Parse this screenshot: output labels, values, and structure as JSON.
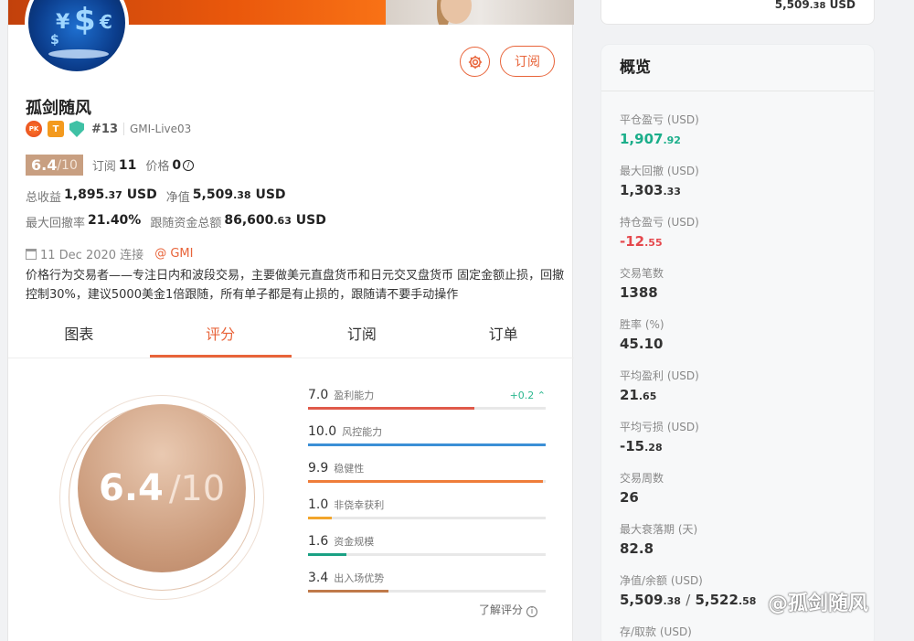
{
  "right_top": {
    "value_main": "5,509",
    "value_small": ".38",
    "unit": "USD"
  },
  "profile": {
    "name": "孤剑随风",
    "badges": {
      "pk": "PK",
      "t": "T"
    },
    "rank": "#13",
    "account": "GMI-Live03",
    "score": "6.4",
    "score_den": "/10",
    "sub_label": "订阅",
    "sub_count": "11",
    "price_label": "价格",
    "price_value": "0",
    "total_profit_label": "总收益",
    "total_profit_main": "1,895",
    "total_profit_small": ".37",
    "total_profit_unit": "USD",
    "equity_label": "净值",
    "equity_main": "5,509",
    "equity_small": ".38",
    "equity_unit": "USD",
    "max_dd_label": "最大回撤率",
    "max_dd_value": "21.40%",
    "follow_label": "跟随资金总额",
    "follow_main": "86,600",
    "follow_small": ".63",
    "follow_unit": "USD",
    "date": "11 Dec 2020 连接",
    "broker": "@ GMI",
    "description": "价格行为交易者——专注日内和波段交易，主要做美元直盘货币和日元交叉盘货币 固定金额止损，回撤控制30%，建议5000美金1倍跟随，所有单子都是有止损的，跟随请不要手动操作",
    "subscribe_button": "订阅"
  },
  "tabs": [
    {
      "label": "图表",
      "active": false
    },
    {
      "label": "评分",
      "active": true
    },
    {
      "label": "订阅",
      "active": false
    },
    {
      "label": "订单",
      "active": false
    }
  ],
  "score_panel": {
    "big_score": "6.4",
    "big_den": "/10",
    "metrics": [
      {
        "score": "7.0",
        "name": "盈利能力",
        "fraction": 0.7,
        "color": "#e05a4a",
        "delta": "+0.2"
      },
      {
        "score": "10.0",
        "name": "风控能力",
        "fraction": 1.0,
        "color": "#3b8fd6",
        "delta": ""
      },
      {
        "score": "9.9",
        "name": "稳健性",
        "fraction": 0.99,
        "color": "#ef7d3a",
        "delta": ""
      },
      {
        "score": "1.0",
        "name": "非侥幸获利",
        "fraction": 0.1,
        "color": "#f2a52c",
        "delta": ""
      },
      {
        "score": "1.6",
        "name": "资金规模",
        "fraction": 0.16,
        "color": "#1aa184",
        "delta": ""
      },
      {
        "score": "3.4",
        "name": "出入场优势",
        "fraction": 0.34,
        "color": "#c07a4a",
        "delta": ""
      }
    ],
    "learn_label": "了解评分"
  },
  "overview": {
    "title": "概览",
    "items": [
      {
        "label": "平仓盈亏 (USD)",
        "main": "1,907",
        "small": ".92",
        "tone": "green"
      },
      {
        "label": "最大回撤 (USD)",
        "main": "1,303",
        "small": ".33",
        "tone": ""
      },
      {
        "label": "持仓盈亏 (USD)",
        "main": "-12",
        "small": ".55",
        "tone": "red"
      },
      {
        "label": "交易笔数",
        "main": "1388",
        "small": "",
        "tone": ""
      },
      {
        "label": "胜率 (%)",
        "main": "45.10",
        "small": "",
        "tone": ""
      },
      {
        "label": "平均盈利 (USD)",
        "main": "21",
        "small": ".65",
        "tone": ""
      },
      {
        "label": "平均亏损 (USD)",
        "main": "-15",
        "small": ".28",
        "tone": ""
      },
      {
        "label": "交易周数",
        "main": "26",
        "small": "",
        "tone": ""
      },
      {
        "label": "最大衰落期 (天)",
        "main": "82.8",
        "small": "",
        "tone": ""
      },
      {
        "label": "净值/余额 (USD)",
        "main": "5,509",
        "small": ".38",
        "main2": "5,522",
        "small2": ".58",
        "tone": ""
      },
      {
        "label": "存/取款 (USD)",
        "main": "",
        "small": "",
        "tone": ""
      }
    ]
  },
  "watermark": "@孤剑随风"
}
